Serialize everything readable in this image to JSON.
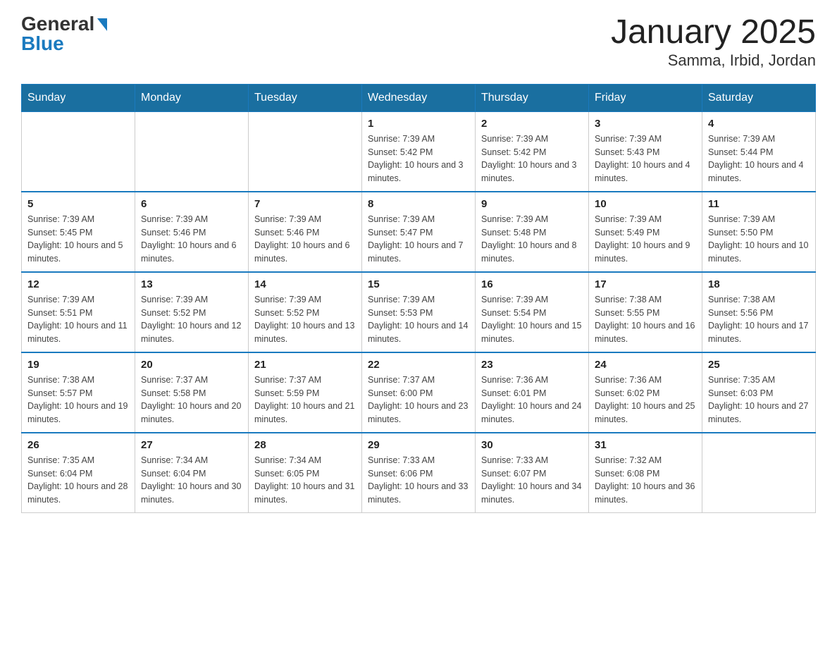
{
  "logo": {
    "general": "General",
    "blue": "Blue"
  },
  "title": "January 2025",
  "subtitle": "Samma, Irbid, Jordan",
  "days_of_week": [
    "Sunday",
    "Monday",
    "Tuesday",
    "Wednesday",
    "Thursday",
    "Friday",
    "Saturday"
  ],
  "weeks": [
    [
      {
        "day": "",
        "info": ""
      },
      {
        "day": "",
        "info": ""
      },
      {
        "day": "",
        "info": ""
      },
      {
        "day": "1",
        "info": "Sunrise: 7:39 AM\nSunset: 5:42 PM\nDaylight: 10 hours and 3 minutes."
      },
      {
        "day": "2",
        "info": "Sunrise: 7:39 AM\nSunset: 5:42 PM\nDaylight: 10 hours and 3 minutes."
      },
      {
        "day": "3",
        "info": "Sunrise: 7:39 AM\nSunset: 5:43 PM\nDaylight: 10 hours and 4 minutes."
      },
      {
        "day": "4",
        "info": "Sunrise: 7:39 AM\nSunset: 5:44 PM\nDaylight: 10 hours and 4 minutes."
      }
    ],
    [
      {
        "day": "5",
        "info": "Sunrise: 7:39 AM\nSunset: 5:45 PM\nDaylight: 10 hours and 5 minutes."
      },
      {
        "day": "6",
        "info": "Sunrise: 7:39 AM\nSunset: 5:46 PM\nDaylight: 10 hours and 6 minutes."
      },
      {
        "day": "7",
        "info": "Sunrise: 7:39 AM\nSunset: 5:46 PM\nDaylight: 10 hours and 6 minutes."
      },
      {
        "day": "8",
        "info": "Sunrise: 7:39 AM\nSunset: 5:47 PM\nDaylight: 10 hours and 7 minutes."
      },
      {
        "day": "9",
        "info": "Sunrise: 7:39 AM\nSunset: 5:48 PM\nDaylight: 10 hours and 8 minutes."
      },
      {
        "day": "10",
        "info": "Sunrise: 7:39 AM\nSunset: 5:49 PM\nDaylight: 10 hours and 9 minutes."
      },
      {
        "day": "11",
        "info": "Sunrise: 7:39 AM\nSunset: 5:50 PM\nDaylight: 10 hours and 10 minutes."
      }
    ],
    [
      {
        "day": "12",
        "info": "Sunrise: 7:39 AM\nSunset: 5:51 PM\nDaylight: 10 hours and 11 minutes."
      },
      {
        "day": "13",
        "info": "Sunrise: 7:39 AM\nSunset: 5:52 PM\nDaylight: 10 hours and 12 minutes."
      },
      {
        "day": "14",
        "info": "Sunrise: 7:39 AM\nSunset: 5:52 PM\nDaylight: 10 hours and 13 minutes."
      },
      {
        "day": "15",
        "info": "Sunrise: 7:39 AM\nSunset: 5:53 PM\nDaylight: 10 hours and 14 minutes."
      },
      {
        "day": "16",
        "info": "Sunrise: 7:39 AM\nSunset: 5:54 PM\nDaylight: 10 hours and 15 minutes."
      },
      {
        "day": "17",
        "info": "Sunrise: 7:38 AM\nSunset: 5:55 PM\nDaylight: 10 hours and 16 minutes."
      },
      {
        "day": "18",
        "info": "Sunrise: 7:38 AM\nSunset: 5:56 PM\nDaylight: 10 hours and 17 minutes."
      }
    ],
    [
      {
        "day": "19",
        "info": "Sunrise: 7:38 AM\nSunset: 5:57 PM\nDaylight: 10 hours and 19 minutes."
      },
      {
        "day": "20",
        "info": "Sunrise: 7:37 AM\nSunset: 5:58 PM\nDaylight: 10 hours and 20 minutes."
      },
      {
        "day": "21",
        "info": "Sunrise: 7:37 AM\nSunset: 5:59 PM\nDaylight: 10 hours and 21 minutes."
      },
      {
        "day": "22",
        "info": "Sunrise: 7:37 AM\nSunset: 6:00 PM\nDaylight: 10 hours and 23 minutes."
      },
      {
        "day": "23",
        "info": "Sunrise: 7:36 AM\nSunset: 6:01 PM\nDaylight: 10 hours and 24 minutes."
      },
      {
        "day": "24",
        "info": "Sunrise: 7:36 AM\nSunset: 6:02 PM\nDaylight: 10 hours and 25 minutes."
      },
      {
        "day": "25",
        "info": "Sunrise: 7:35 AM\nSunset: 6:03 PM\nDaylight: 10 hours and 27 minutes."
      }
    ],
    [
      {
        "day": "26",
        "info": "Sunrise: 7:35 AM\nSunset: 6:04 PM\nDaylight: 10 hours and 28 minutes."
      },
      {
        "day": "27",
        "info": "Sunrise: 7:34 AM\nSunset: 6:04 PM\nDaylight: 10 hours and 30 minutes."
      },
      {
        "day": "28",
        "info": "Sunrise: 7:34 AM\nSunset: 6:05 PM\nDaylight: 10 hours and 31 minutes."
      },
      {
        "day": "29",
        "info": "Sunrise: 7:33 AM\nSunset: 6:06 PM\nDaylight: 10 hours and 33 minutes."
      },
      {
        "day": "30",
        "info": "Sunrise: 7:33 AM\nSunset: 6:07 PM\nDaylight: 10 hours and 34 minutes."
      },
      {
        "day": "31",
        "info": "Sunrise: 7:32 AM\nSunset: 6:08 PM\nDaylight: 10 hours and 36 minutes."
      },
      {
        "day": "",
        "info": ""
      }
    ]
  ]
}
